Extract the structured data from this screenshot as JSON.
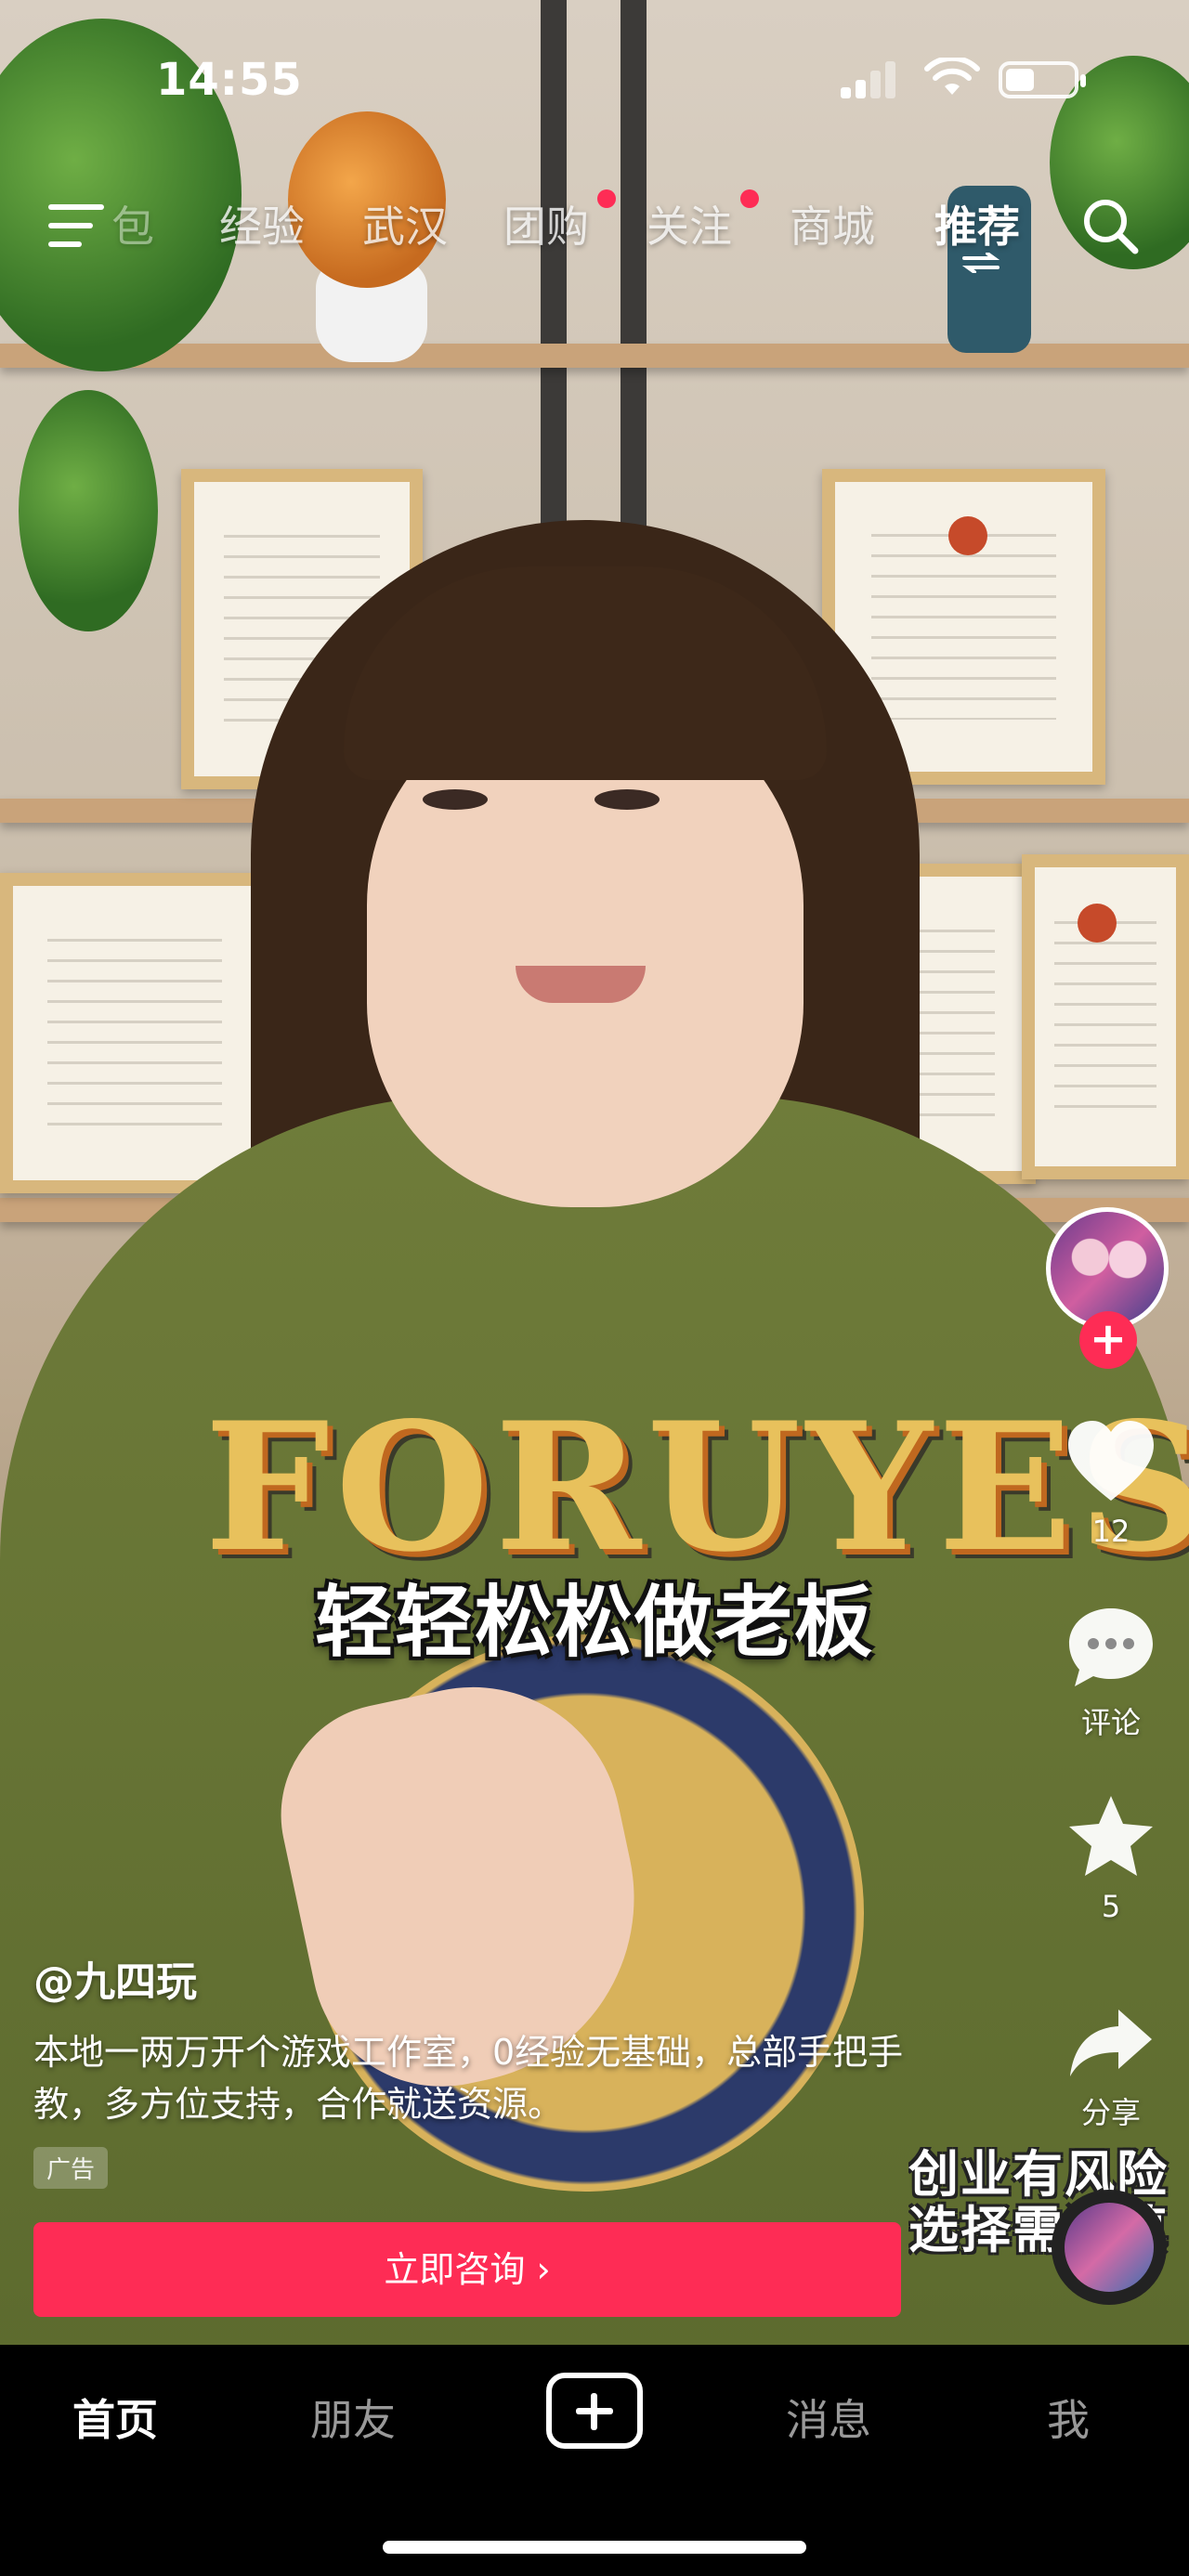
{
  "status_bar": {
    "time": "14:55"
  },
  "top_nav": {
    "tabs": [
      {
        "label": "经验",
        "active": false,
        "dot": false
      },
      {
        "label": "武汉",
        "active": false,
        "dot": false
      },
      {
        "label": "团购",
        "active": false,
        "dot": true
      },
      {
        "label": "关注",
        "active": false,
        "dot": true
      },
      {
        "label": "商城",
        "active": false,
        "dot": false
      },
      {
        "label": "推荐",
        "active": true,
        "dot": false
      }
    ],
    "partial_tab_glyph": "包"
  },
  "video": {
    "subtitle": "轻轻松松做老板",
    "sweater_print": "FORUYES"
  },
  "actions": {
    "like_count": "12",
    "comment_label": "评论",
    "favorite_count": "5",
    "share_label": "分享"
  },
  "post": {
    "username": "@九四玩",
    "description": "本地一两万开个游戏工作室，0经验无基础，总部手把手教，多方位支持，合作就送资源。",
    "ad_label": "广告",
    "cta_label": "立即咨询 ›",
    "risk_notice_line1": "创业有风险",
    "risk_notice_line2": "选择需谨慎"
  },
  "tab_bar": {
    "home": "首页",
    "friends": "朋友",
    "messages": "消息",
    "me": "我"
  },
  "colors": {
    "accent": "#fe2c55",
    "tab_bar_bg": "#000000"
  },
  "icons": [
    "menu-icon",
    "search-icon",
    "heart-icon",
    "comment-icon",
    "star-icon",
    "share-icon",
    "plus-icon",
    "music-disc-icon"
  ]
}
